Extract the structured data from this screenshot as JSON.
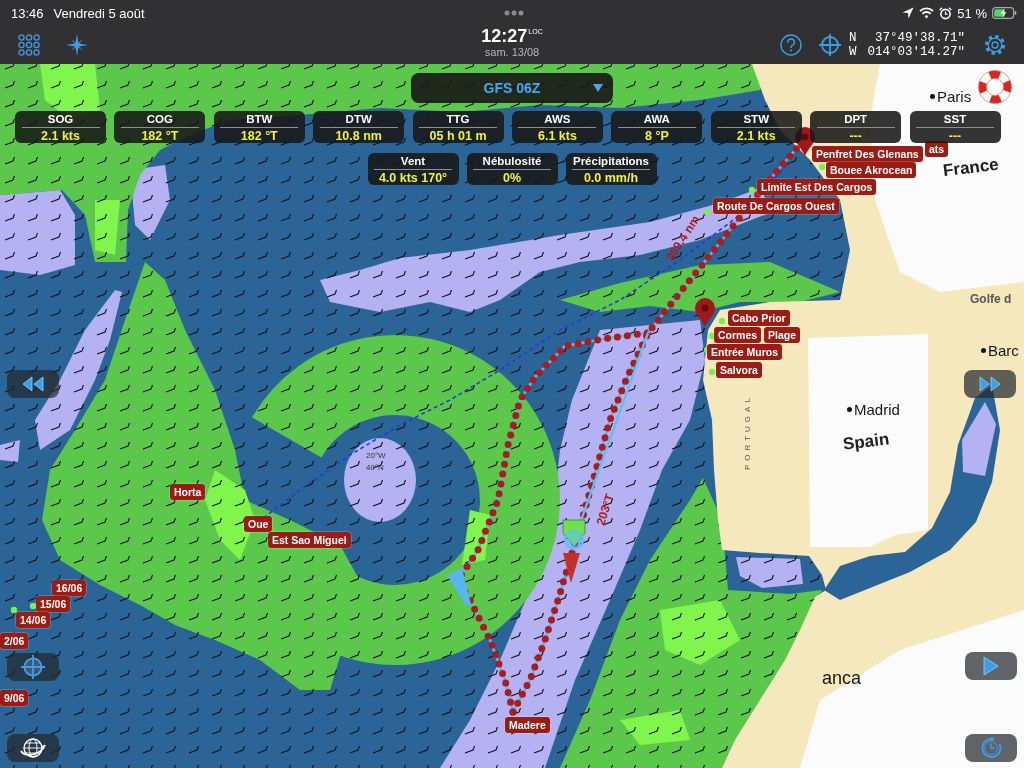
{
  "status_bar": {
    "time": "13:46",
    "date": "Vendredi 5 août",
    "battery": "51 %"
  },
  "toolbar": {
    "clock": {
      "time": "12:27",
      "zone": "LOC",
      "date": "sam. 13/08"
    },
    "position": [
      {
        "hemisphere": "N",
        "value": "37°49'38.71\""
      },
      {
        "hemisphere": "W",
        "value": "014°03'14.27\""
      }
    ]
  },
  "weather_model": {
    "label": "GFS 06Z"
  },
  "instruments": [
    {
      "label": "SOG",
      "value": "2.1 kts"
    },
    {
      "label": "COG",
      "value": "182 °T"
    },
    {
      "label": "BTW",
      "value": "182 °T"
    },
    {
      "label": "DTW",
      "value": "10.8 nm"
    },
    {
      "label": "TTG",
      "value": "05 h 01 m"
    },
    {
      "label": "AWS",
      "value": "6.1 kts"
    },
    {
      "label": "AWA",
      "value": "8 °P"
    },
    {
      "label": "STW",
      "value": "2.1 kts"
    },
    {
      "label": "DPT",
      "value": "---"
    },
    {
      "label": "SST",
      "value": "---"
    }
  ],
  "weather": [
    {
      "label": "Vent",
      "value": "4.0 kts 170°"
    },
    {
      "label": "Nébulosité",
      "value": "0%"
    },
    {
      "label": "Précipitations",
      "value": "0.0 mm/h"
    }
  ],
  "map": {
    "places": [
      {
        "name": "Paris",
        "kind": "city"
      },
      {
        "name": "France",
        "kind": "country"
      },
      {
        "name": "Golfe d",
        "kind": "sea"
      },
      {
        "name": "Barc",
        "kind": "city"
      },
      {
        "name": "Madrid",
        "kind": "city"
      },
      {
        "name": "Spain",
        "kind": "country"
      },
      {
        "name": "PORTUGAL",
        "kind": "chart"
      },
      {
        "name": "anca",
        "kind": "place"
      },
      {
        "name": "20°W",
        "kind": "grid"
      },
      {
        "name": "40°N",
        "kind": "grid"
      }
    ],
    "waypoints": [
      {
        "name": "ats"
      },
      {
        "name": "Penfret Des Glenans"
      },
      {
        "name": "Bouee Akrocean"
      },
      {
        "name": "Limite Est Des Cargos"
      },
      {
        "name": "Route De Cargos Ouest"
      },
      {
        "name": "Cabo Prior"
      },
      {
        "name": "Cormes"
      },
      {
        "name": "Plage"
      },
      {
        "name": "Entrée Muros"
      },
      {
        "name": "Salvora"
      },
      {
        "name": "Horta"
      },
      {
        "name": "Oue"
      },
      {
        "name": "Est Sao Miguel"
      },
      {
        "name": "Madere"
      }
    ],
    "track_dates": [
      "16/06",
      "15/06",
      "14/06",
      "2/06",
      "9/06"
    ],
    "route_labels": [
      "369.4 nm",
      "203°T"
    ]
  }
}
